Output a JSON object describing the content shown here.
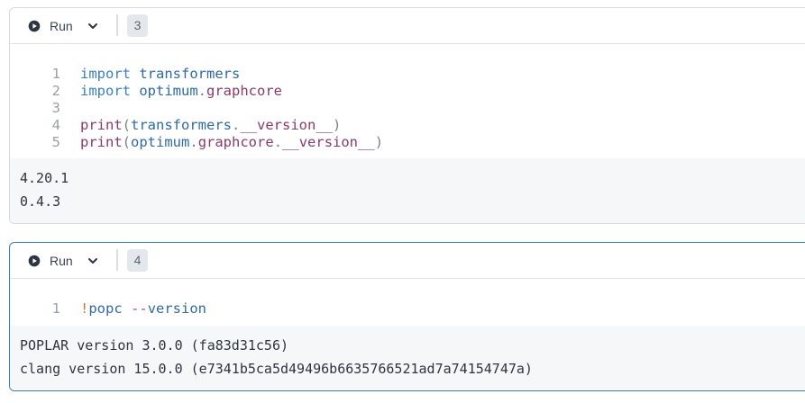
{
  "cells": [
    {
      "run_label": "Run",
      "exec_count": "3",
      "code": [
        {
          "num": "1",
          "tokens": [
            {
              "t": "import",
              "c": "kw"
            },
            {
              "t": " ",
              "c": ""
            },
            {
              "t": "transformers",
              "c": "mod"
            }
          ]
        },
        {
          "num": "2",
          "tokens": [
            {
              "t": "import",
              "c": "kw"
            },
            {
              "t": " ",
              "c": ""
            },
            {
              "t": "optimum",
              "c": "mod"
            },
            {
              "t": ".",
              "c": "dot"
            },
            {
              "t": "graphcore",
              "c": "attr"
            }
          ]
        },
        {
          "num": "3",
          "tokens": []
        },
        {
          "num": "4",
          "tokens": [
            {
              "t": "print",
              "c": "fn"
            },
            {
              "t": "(",
              "c": "paren"
            },
            {
              "t": "transformers",
              "c": "mod"
            },
            {
              "t": ".",
              "c": "dot"
            },
            {
              "t": "__version__",
              "c": "attr"
            },
            {
              "t": ")",
              "c": "paren"
            }
          ]
        },
        {
          "num": "5",
          "tokens": [
            {
              "t": "print",
              "c": "fn"
            },
            {
              "t": "(",
              "c": "paren"
            },
            {
              "t": "optimum",
              "c": "mod"
            },
            {
              "t": ".",
              "c": "dot"
            },
            {
              "t": "graphcore",
              "c": "attr"
            },
            {
              "t": ".",
              "c": "dot"
            },
            {
              "t": "__version__",
              "c": "attr"
            },
            {
              "t": ")",
              "c": "paren"
            }
          ]
        }
      ],
      "output": [
        "4.20.1",
        "0.4.3"
      ]
    },
    {
      "run_label": "Run",
      "exec_count": "4",
      "code": [
        {
          "num": "1",
          "tokens": [
            {
              "t": "!",
              "c": "bang"
            },
            {
              "t": "popc",
              "c": "mod"
            },
            {
              "t": " ",
              "c": ""
            },
            {
              "t": "--",
              "c": "op"
            },
            {
              "t": "version",
              "c": "flag"
            }
          ]
        }
      ],
      "output": [
        "POPLAR version 3.0.0 (fa83d31c56)",
        "clang version 15.0.0 (e7341b5ca5d49496b6635766521ad7a74154747a)"
      ]
    }
  ],
  "icons": {
    "run": "play-circle-icon",
    "dropdown": "chevron-down-icon"
  },
  "colors": {
    "active_border": "#3e7fb0",
    "keyword": "#3a7fbf",
    "attribute": "#8a3a6a",
    "bang": "#d4743b"
  }
}
